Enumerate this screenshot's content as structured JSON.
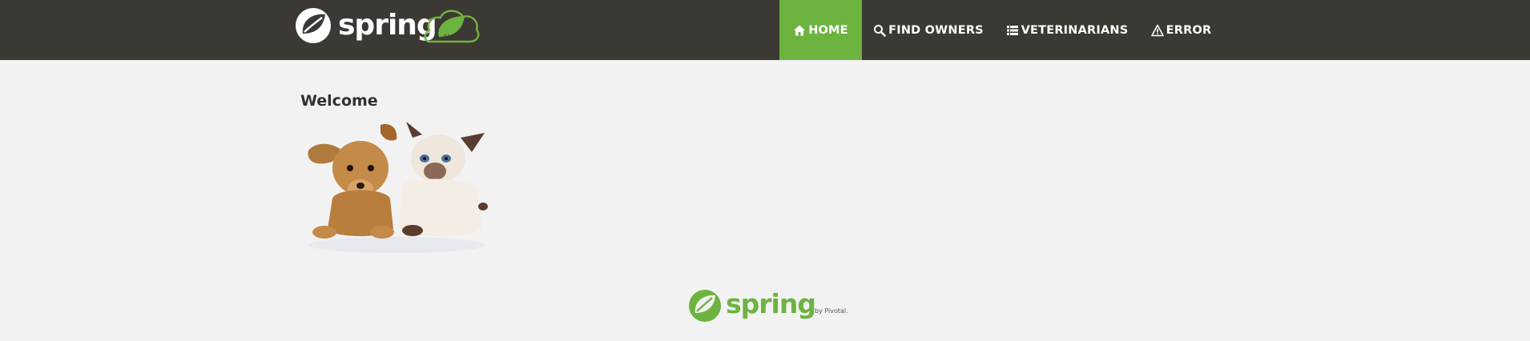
{
  "navbar": {
    "brand": {
      "text": "spring",
      "icon": "spring-leaf-logo"
    },
    "items": [
      {
        "label": "HOME",
        "icon": "home-icon",
        "active": true
      },
      {
        "label": "FIND OWNERS",
        "icon": "search-icon",
        "active": false
      },
      {
        "label": "VETERINARIANS",
        "icon": "list-icon",
        "active": false
      },
      {
        "label": "ERROR",
        "icon": "warning-icon",
        "active": false
      }
    ]
  },
  "main": {
    "title": "Welcome",
    "image": "puppy-and-kitten"
  },
  "footer": {
    "logo_text": "spring",
    "byline": "by Pivotal."
  },
  "colors": {
    "navbar_bg": "#3c3834",
    "accent_green": "#6db33f",
    "page_bg": "#f2f2f2",
    "title_text": "#34302d"
  }
}
